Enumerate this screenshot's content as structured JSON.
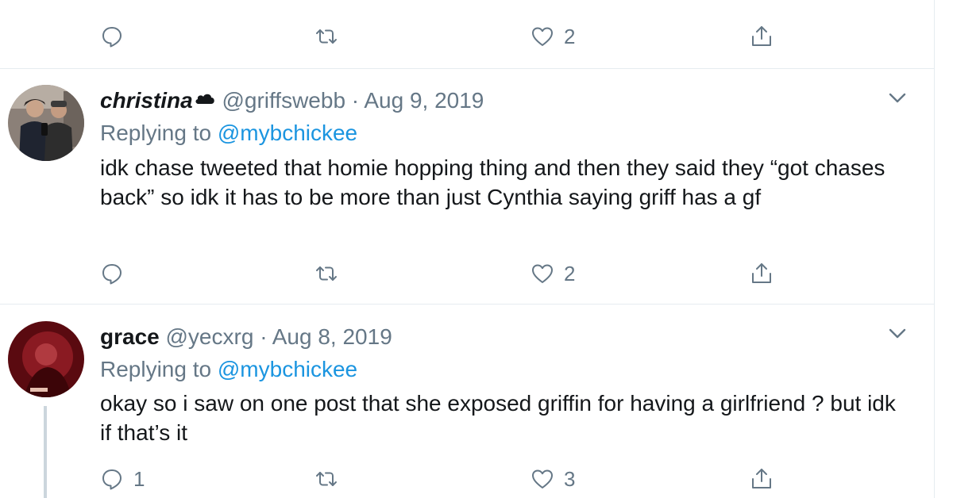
{
  "top_actions": {
    "reply_count": "",
    "retweet_count": "",
    "like_count": "2"
  },
  "tweets": [
    {
      "name": "christina",
      "handle": "@griffswebb",
      "separator": "·",
      "date": "Aug 9, 2019",
      "replying_prefix": "Replying to",
      "replying_to": "@mybchickee",
      "text": "idk chase tweeted that homie hopping thing and then they said they “got chases back” so idk it has to be more than just Cynthia saying griff has a gf",
      "reply_count": "",
      "retweet_count": "",
      "like_count": "2"
    },
    {
      "name": "grace",
      "handle": "@yecxrg",
      "separator": "·",
      "date": "Aug 8, 2019",
      "replying_prefix": "Replying to",
      "replying_to": "@mybchickee",
      "text": "okay so i saw on one post that she exposed griffin for having a girlfriend ? but idk if that’s it",
      "reply_count": "1",
      "retweet_count": "",
      "like_count": "3"
    }
  ],
  "icons": {
    "reply": "speech-bubble-icon",
    "retweet": "retweet-arrows-icon",
    "like": "heart-icon",
    "share": "share-upload-icon",
    "more": "chevron-down-icon"
  },
  "colors": {
    "link": "#1b95e0",
    "secondary": "#657786",
    "divider": "#e6ecf0",
    "text": "#14171a"
  }
}
